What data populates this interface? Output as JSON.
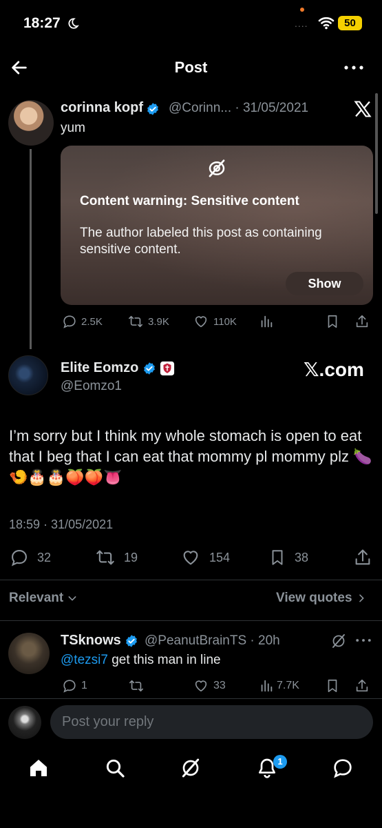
{
  "status_bar": {
    "time": "18:27",
    "battery": "50",
    "signal": "...."
  },
  "header": {
    "title": "Post"
  },
  "quoted_post": {
    "author_name": "corinna kopf",
    "handle_date": "@Corinn... · 31/05/2021",
    "text": "yum",
    "warning_title": "Content warning: Sensitive content",
    "warning_body": "The author labeled this post as containing sensitive content.",
    "show_label": "Show",
    "replies": "2.5K",
    "reposts": "3.9K",
    "likes": "110K"
  },
  "main_post": {
    "author_name": "Elite Eomzo",
    "handle": "@Eomzo1",
    "watermark": "𝕏.com",
    "text": "I’m sorry but I think my whole stomach is open to eat that I beg that I can eat that mommy pl mommy plz  🍆🍤🎂🎂🍑🍑👅",
    "timestamp": "18:59 · 31/05/2021",
    "replies": "32",
    "reposts": "19",
    "likes": "154",
    "bookmarks": "38"
  },
  "sort": {
    "relevant_label": "Relevant",
    "view_quotes_label": "View quotes"
  },
  "reply": {
    "author_name": "TSknows",
    "handle_time": "@PeanutBrainTS · 20h",
    "mention": "@tezsi7",
    "text": " get this man in line",
    "replies": "1",
    "likes": "33",
    "views": "7.7K"
  },
  "composer": {
    "placeholder": "Post your reply"
  },
  "tabbar": {
    "notifications_badge": "1"
  },
  "colors": {
    "accent": "#1d9bf0",
    "background": "#000000",
    "muted": "#8b9299"
  }
}
